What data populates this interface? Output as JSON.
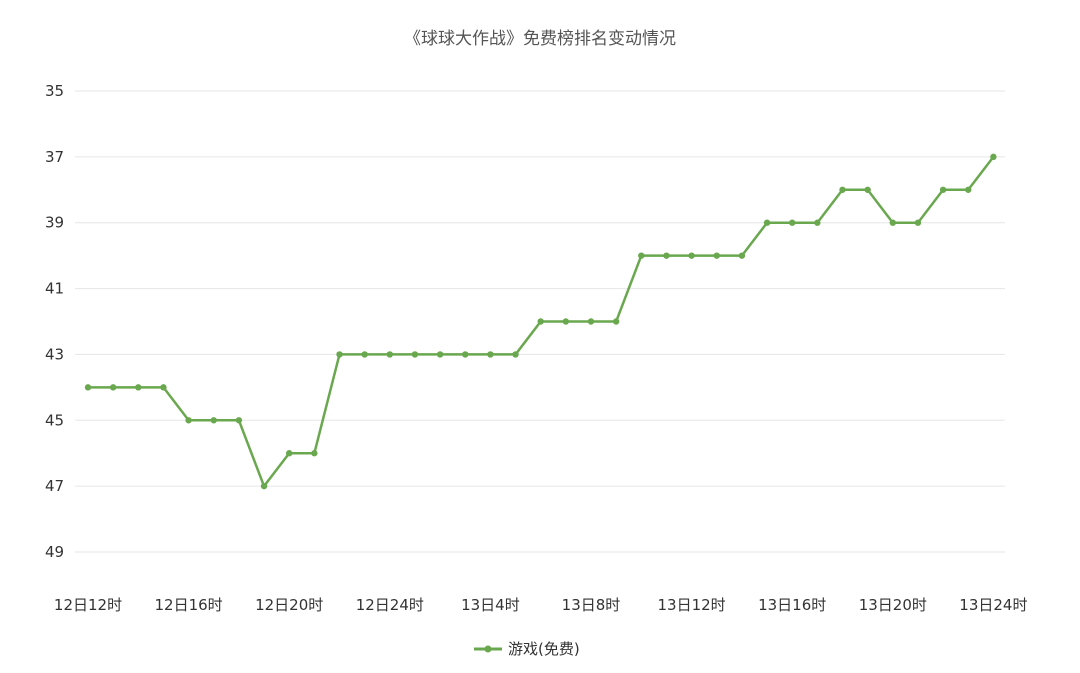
{
  "chart_data": {
    "type": "line",
    "title": "《球球大作战》免费榜排名变动情况",
    "xlabel": "",
    "ylabel": "",
    "y_inverted": true,
    "ylim": [
      35,
      49
    ],
    "yticks": [
      35,
      37,
      39,
      41,
      43,
      45,
      47,
      49
    ],
    "x_tick_labels": [
      "12日12时",
      "12日16时",
      "12日20时",
      "12日24时",
      "13日4时",
      "13日8时",
      "13日12时",
      "13日16时",
      "13日20时",
      "13日24时"
    ],
    "x": [
      12,
      13,
      14,
      15,
      16,
      17,
      18,
      19,
      20,
      21,
      22,
      23,
      24,
      25,
      26,
      27,
      28,
      29,
      30,
      31,
      32,
      33,
      34,
      35,
      36,
      37,
      38,
      39,
      40,
      41,
      42,
      43,
      44,
      45,
      46,
      47,
      48
    ],
    "series": [
      {
        "name": "游戏(免费)",
        "color": "#6aa84f",
        "values": [
          44,
          44,
          44,
          44,
          45,
          45,
          45,
          47,
          46,
          46,
          43,
          43,
          43,
          43,
          43,
          43,
          43,
          43,
          42,
          42,
          42,
          42,
          40,
          40,
          40,
          40,
          40,
          39,
          39,
          39,
          38,
          38,
          39,
          39,
          38,
          38,
          37
        ]
      }
    ],
    "grid": true,
    "legend_position": "bottom-center"
  }
}
